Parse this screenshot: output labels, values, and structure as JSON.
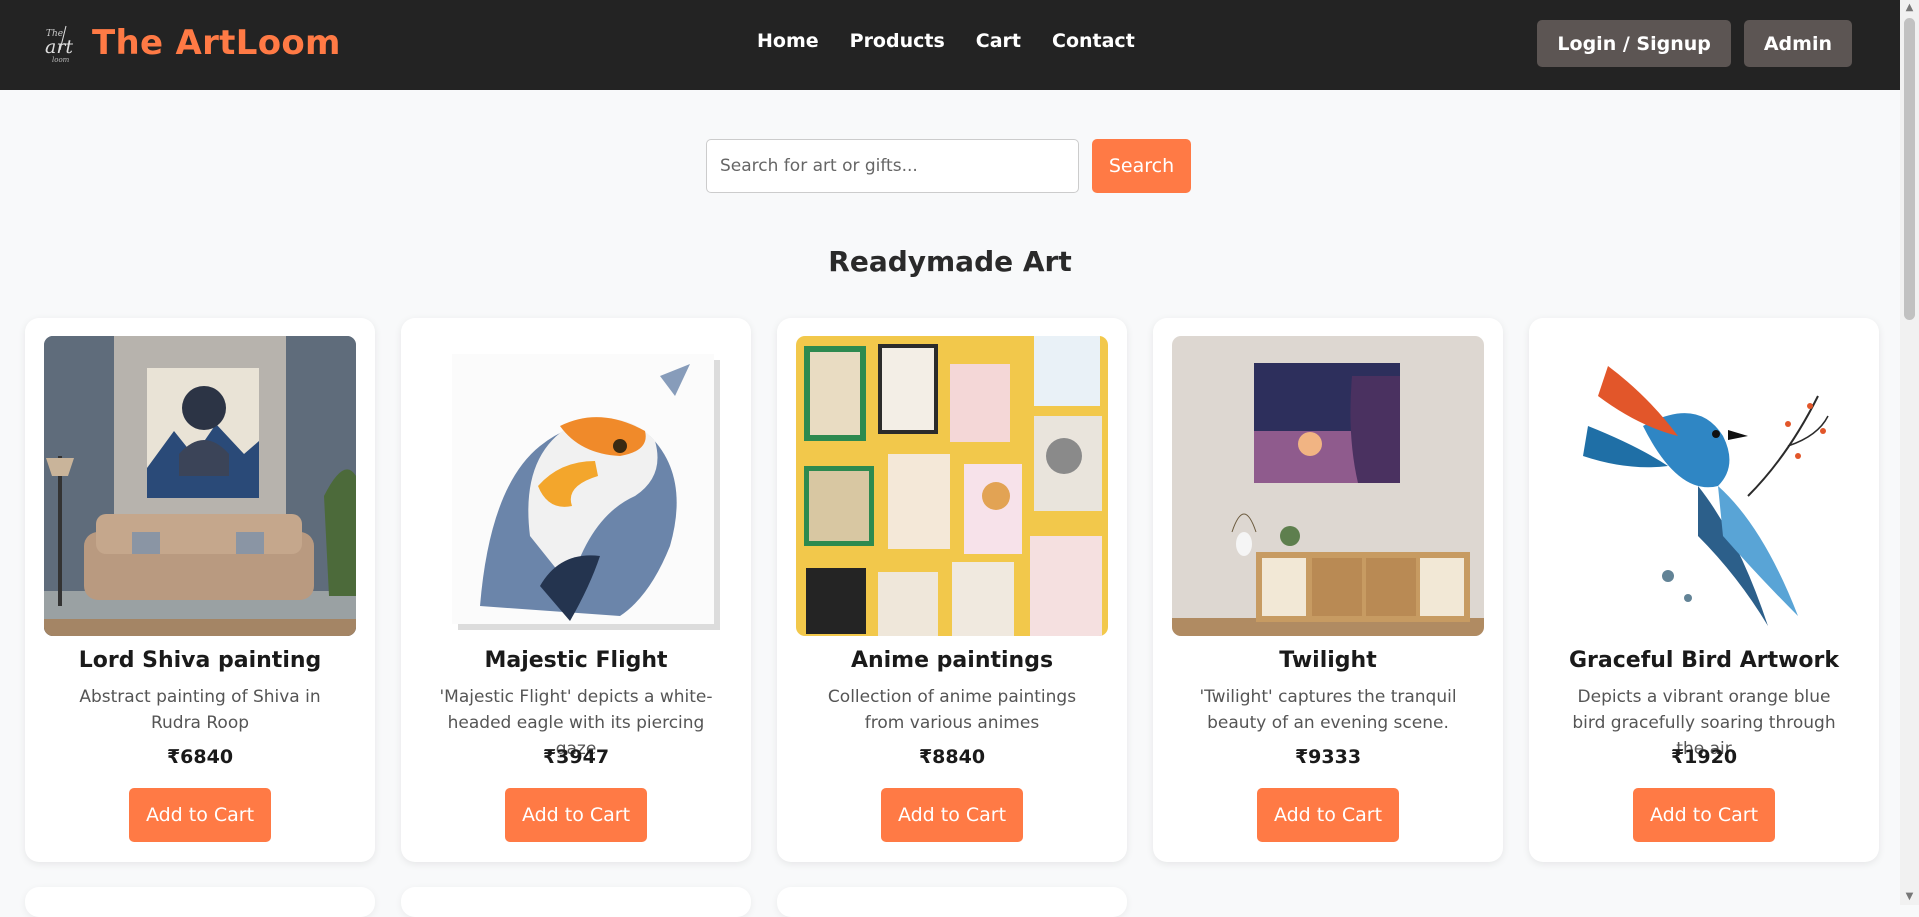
{
  "brand": {
    "name": "The ArtLoom",
    "logo_icon": "artloom-logo-icon",
    "color": "#ff7a45"
  },
  "nav": {
    "links": [
      "Home",
      "Products",
      "Cart",
      "Contact"
    ],
    "login_label": "Login / Signup",
    "admin_label": "Admin"
  },
  "search": {
    "placeholder": "Search for art or gifts...",
    "value": "",
    "button_label": "Search"
  },
  "section": {
    "title": "Readymade Art"
  },
  "products": [
    {
      "title": "Lord Shiva painting",
      "desc": "Abstract painting of Shiva in Rudra Roop",
      "price": "₹6840",
      "button": "Add to Cart"
    },
    {
      "title": "Majestic Flight",
      "desc": "'Majestic Flight' depicts a white-headed eagle with its piercing gaze",
      "price": "₹3947",
      "button": "Add to Cart"
    },
    {
      "title": "Anime paintings",
      "desc": "Collection of anime paintings from various animes",
      "price": "₹8840",
      "button": "Add to Cart"
    },
    {
      "title": "Twilight",
      "desc": "'Twilight' captures the tranquil beauty of an evening scene.",
      "price": "₹9333",
      "button": "Add to Cart"
    },
    {
      "title": "Graceful Bird Artwork",
      "desc": "Depicts a vibrant orange blue bird gracefully soaring through the air",
      "price": "₹1920",
      "button": "Add to Cart"
    }
  ],
  "colors": {
    "navbar": "#232323",
    "accent": "#ff7a45",
    "nav_button": "#5c5553"
  }
}
